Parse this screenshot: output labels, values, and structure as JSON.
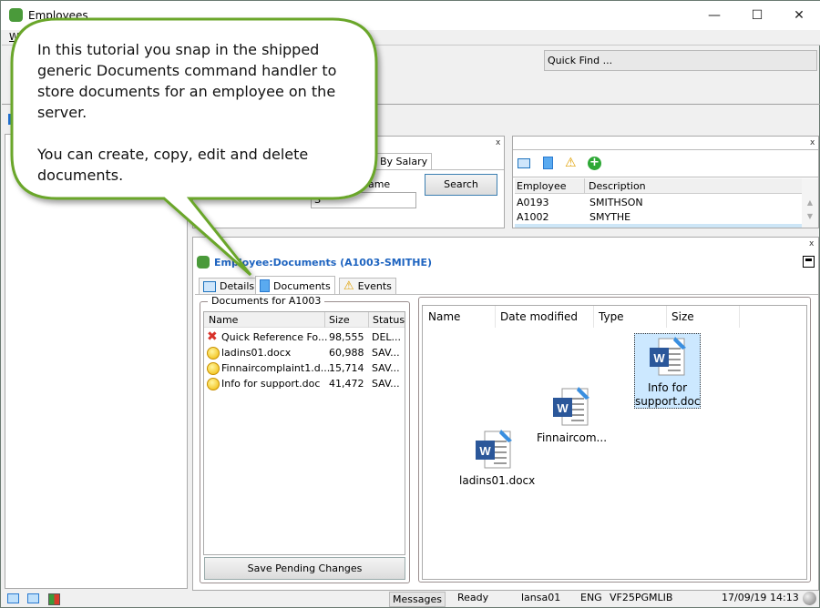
{
  "window": {
    "title": "Employees",
    "menu_first": "Wi"
  },
  "quick_find": {
    "label": "Quick Find ..."
  },
  "search_panel": {
    "tab_label": "By Salary",
    "field_label": "name",
    "input_value": "S",
    "search_button": "Search",
    "close": "x"
  },
  "employee_list": {
    "close": "x",
    "columns": [
      "Employee",
      "Description"
    ],
    "rows": [
      {
        "employee": "A0193",
        "description": "SMITHSON"
      },
      {
        "employee": "A1002",
        "description": "SMYTHE"
      }
    ]
  },
  "documents_panel": {
    "close": "x",
    "title": "Employee:Documents (A1003-SMITHE)",
    "tabs": [
      {
        "label": "Details"
      },
      {
        "label": "Documents"
      },
      {
        "label": "Events"
      }
    ],
    "group_title": "Documents for A1003",
    "columns": [
      "Name",
      "Size",
      "Status"
    ],
    "rows": [
      {
        "name": "Quick Reference Fo...",
        "size": "98,555",
        "status": "DEL...",
        "icon": "delete"
      },
      {
        "name": "ladins01.docx",
        "size": "60,988",
        "status": "SAV...",
        "icon": "pending"
      },
      {
        "name": "Finnaircomplaint1.d...",
        "size": "15,714",
        "status": "SAV...",
        "icon": "pending"
      },
      {
        "name": "Info for support.doc",
        "size": "41,472",
        "status": "SAV...",
        "icon": "pending"
      }
    ],
    "save_button": "Save Pending Changes",
    "explorer": {
      "columns": [
        "Name",
        "Date modified",
        "Type",
        "Size"
      ],
      "files": [
        {
          "name_line1": "Info for",
          "name_line2": "support.doc",
          "selected": true
        },
        {
          "name": "Finnaircom..."
        },
        {
          "name": "ladins01.docx"
        }
      ]
    }
  },
  "status": {
    "messages": "Messages",
    "state": "Ready",
    "user": "lansa01",
    "lang": "ENG",
    "library": "VF25PGMLIB",
    "date": "17/09/19",
    "time": "14:13"
  },
  "callout": {
    "line1": "In this tutorial you snap in the shipped",
    "line2": "generic Documents command handler to",
    "line3": "store documents for an employee on the",
    "line4": "server.",
    "line5": "You can create, copy, edit and delete",
    "line6": "documents.",
    "border_color": "#6aa62c"
  }
}
